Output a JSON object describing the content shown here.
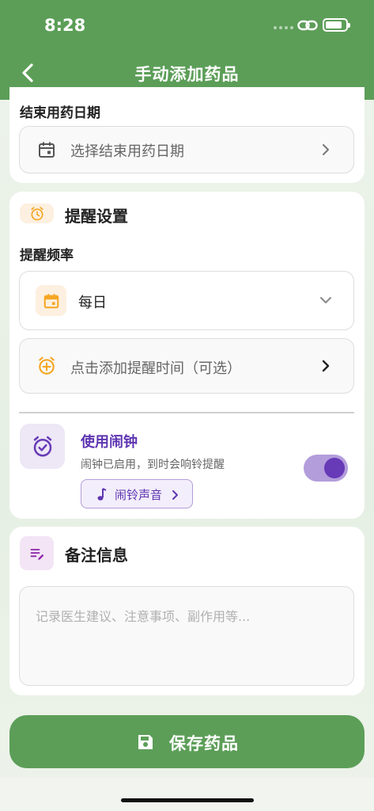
{
  "status_bar": {
    "time": "8:28"
  },
  "header": {
    "title": "手动添加药品"
  },
  "end_date": {
    "label": "结束用药日期",
    "placeholder": "选择结束用药日期"
  },
  "reminder": {
    "title": "提醒设置",
    "frequency_label": "提醒频率",
    "frequency_value": "每日",
    "add_time_label": "点击添加提醒时间（可选）",
    "alarm_title": "使用闹钟",
    "alarm_desc": "闹钟已启用，到时会响铃提醒",
    "alarm_sound_button": "闹铃声音",
    "alarm_enabled": true
  },
  "notes": {
    "title": "备注信息",
    "placeholder": "记录医生建议、注意事项、副作用等..."
  },
  "footer": {
    "save_label": "保存药品"
  },
  "colors": {
    "primary_green": "#5c9e58",
    "orange": "#f5a623",
    "purple": "#673ab7"
  },
  "icons": [
    "back-arrow-icon",
    "calendar-icon",
    "alarm-clock-icon",
    "add-alarm-icon",
    "music-note-icon",
    "notes-edit-icon",
    "save-disk-icon"
  ]
}
